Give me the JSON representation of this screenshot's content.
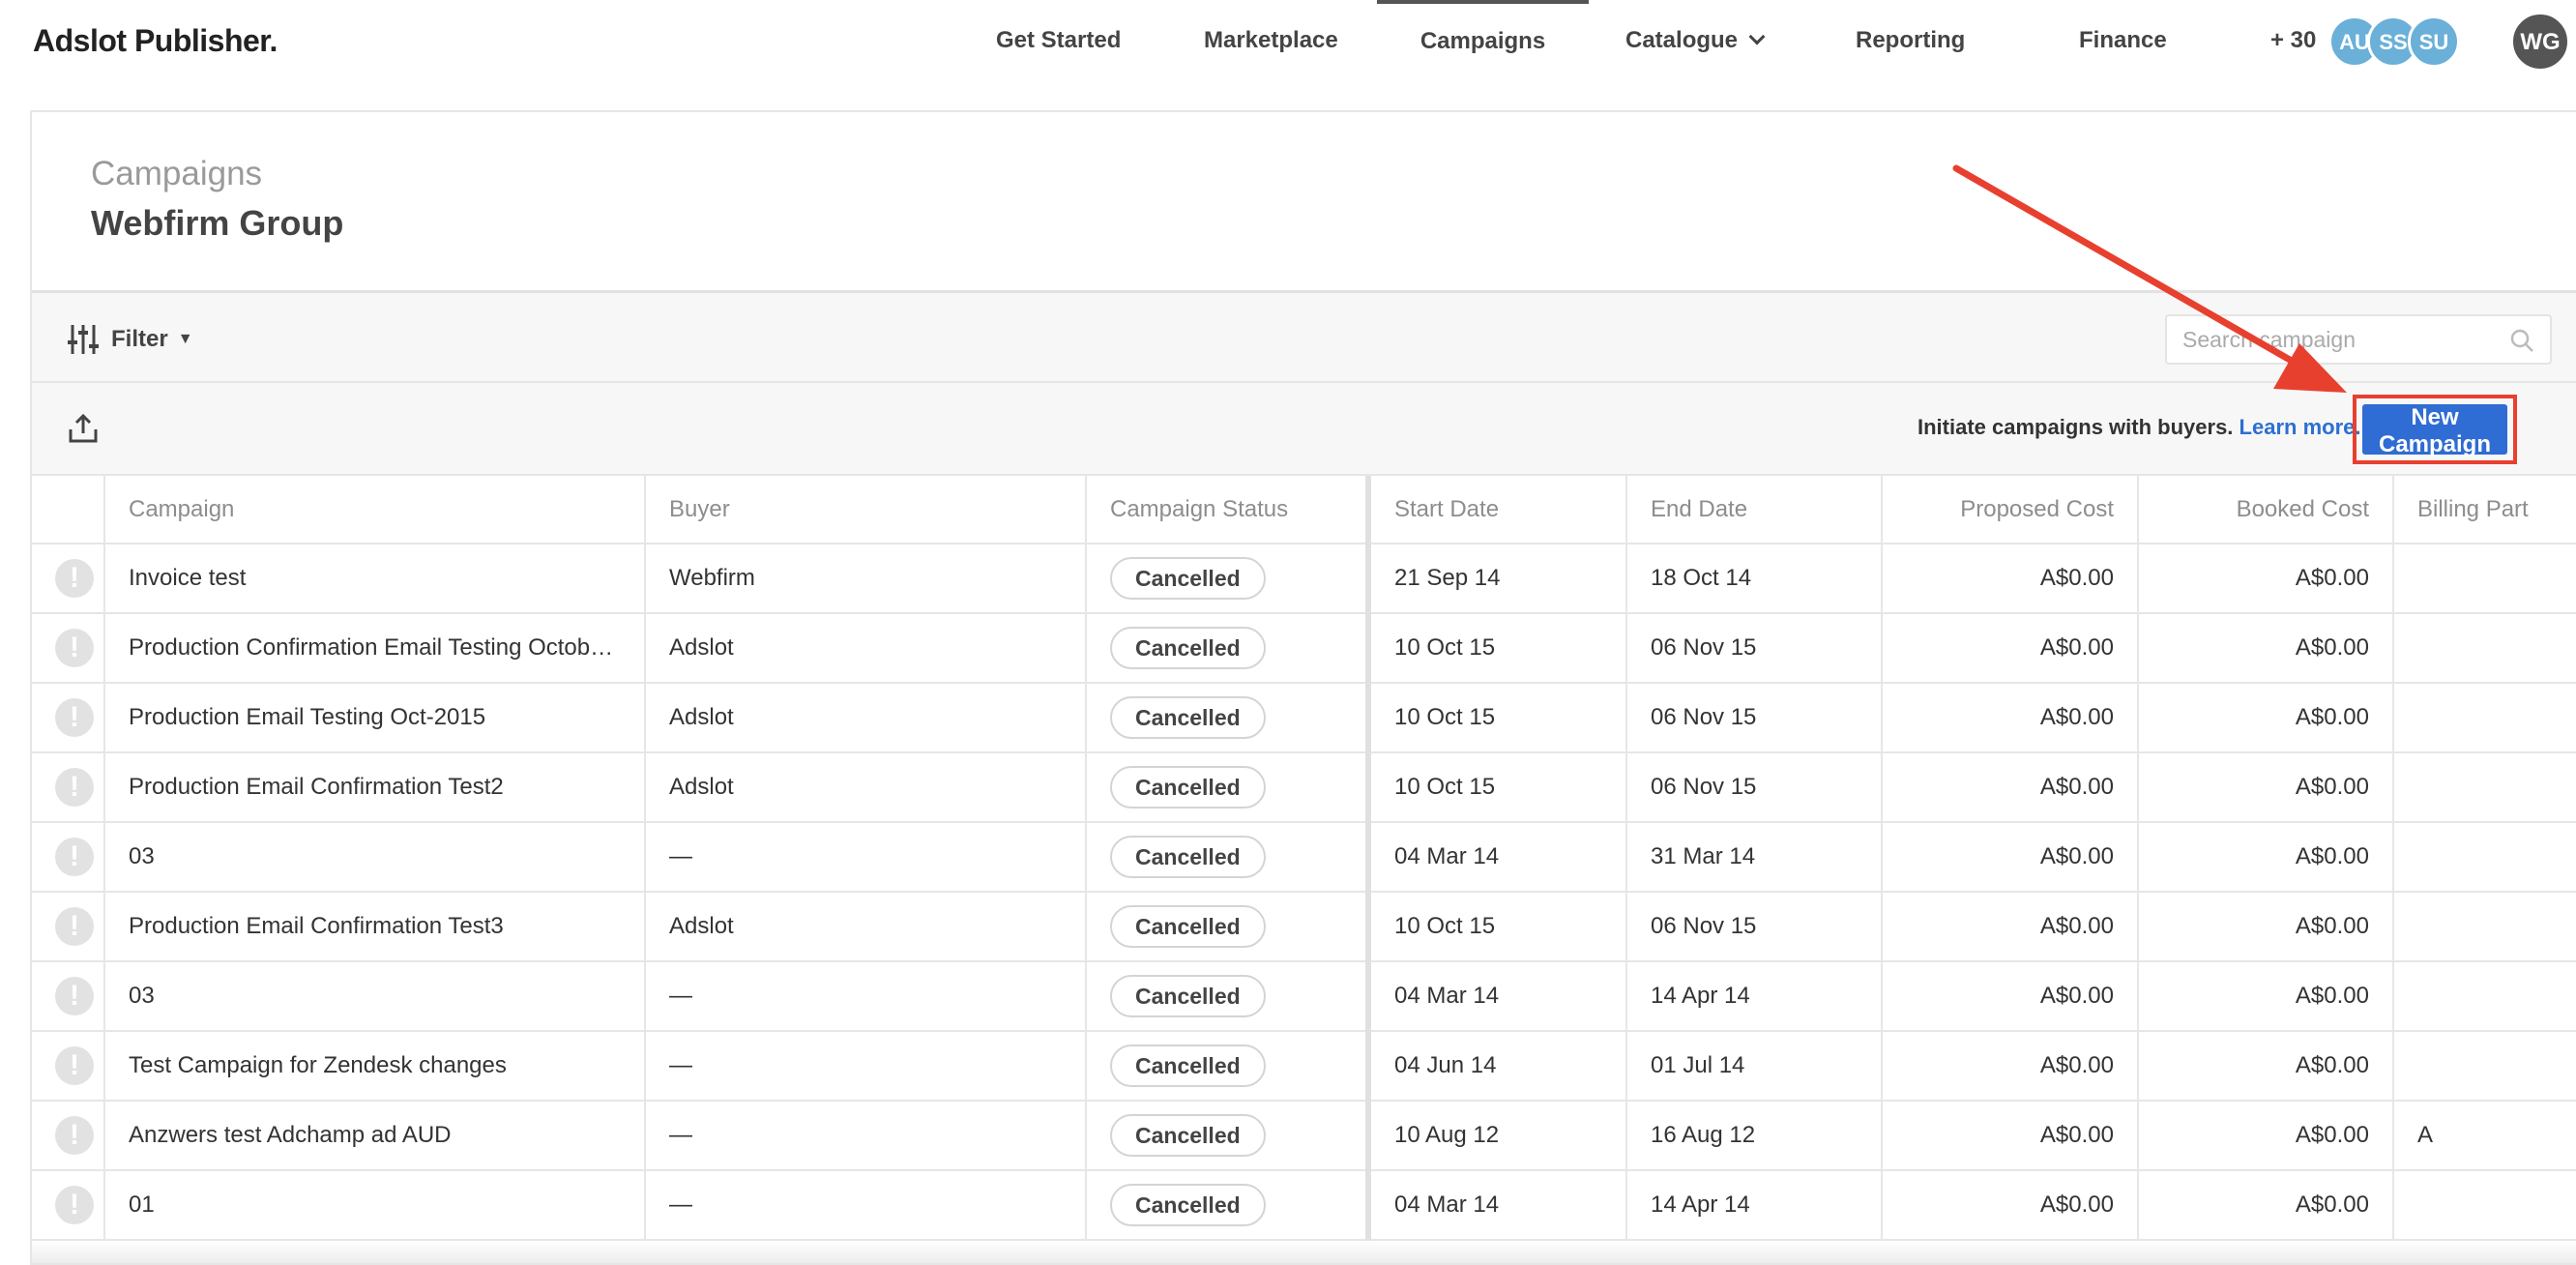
{
  "nav": {
    "brand": "Adslot Publisher.",
    "items": [
      {
        "label": "Get Started"
      },
      {
        "label": "Marketplace"
      },
      {
        "label": "Campaigns"
      },
      {
        "label": "Catalogue"
      },
      {
        "label": "Reporting"
      },
      {
        "label": "Finance"
      }
    ],
    "active": "Campaigns",
    "more_count": "+ 30",
    "avatars": [
      "AU",
      "SS",
      "SU"
    ],
    "user_initials": "WG"
  },
  "header": {
    "title": "Campaigns",
    "subtitle": "Webfirm Group"
  },
  "filter": {
    "label": "Filter",
    "caret": "▼",
    "search_placeholder": "Search campaign"
  },
  "actions": {
    "initiate_text": "Initiate campaigns with buyers.",
    "learn_more": "Learn more.",
    "new_campaign": "New Campaign"
  },
  "table": {
    "columns": [
      "Campaign",
      "Buyer",
      "Campaign Status",
      "Start Date",
      "End Date",
      "Proposed Cost",
      "Booked Cost",
      "Billing Part"
    ],
    "rows": [
      {
        "campaign": "Invoice test",
        "buyer": "Webfirm",
        "status": "Cancelled",
        "start": "21 Sep 14",
        "end": "18 Oct 14",
        "proposed": "A$0.00",
        "booked": "A$0.00",
        "billing": ""
      },
      {
        "campaign": "Production Confirmation Email Testing Octobe…",
        "buyer": "Adslot",
        "status": "Cancelled",
        "start": "10 Oct 15",
        "end": "06 Nov 15",
        "proposed": "A$0.00",
        "booked": "A$0.00",
        "billing": ""
      },
      {
        "campaign": "Production Email Testing Oct-2015",
        "buyer": "Adslot",
        "status": "Cancelled",
        "start": "10 Oct 15",
        "end": "06 Nov 15",
        "proposed": "A$0.00",
        "booked": "A$0.00",
        "billing": ""
      },
      {
        "campaign": "Production Email Confirmation Test2",
        "buyer": "Adslot",
        "status": "Cancelled",
        "start": "10 Oct 15",
        "end": "06 Nov 15",
        "proposed": "A$0.00",
        "booked": "A$0.00",
        "billing": ""
      },
      {
        "campaign": "03",
        "buyer": "—",
        "status": "Cancelled",
        "start": "04 Mar 14",
        "end": "31 Mar 14",
        "proposed": "A$0.00",
        "booked": "A$0.00",
        "billing": ""
      },
      {
        "campaign": "Production Email Confirmation Test3",
        "buyer": "Adslot",
        "status": "Cancelled",
        "start": "10 Oct 15",
        "end": "06 Nov 15",
        "proposed": "A$0.00",
        "booked": "A$0.00",
        "billing": ""
      },
      {
        "campaign": "03",
        "buyer": "—",
        "status": "Cancelled",
        "start": "04 Mar 14",
        "end": "14 Apr 14",
        "proposed": "A$0.00",
        "booked": "A$0.00",
        "billing": ""
      },
      {
        "campaign": "Test Campaign for Zendesk changes",
        "buyer": "—",
        "status": "Cancelled",
        "start": "04 Jun 14",
        "end": "01 Jul 14",
        "proposed": "A$0.00",
        "booked": "A$0.00",
        "billing": ""
      },
      {
        "campaign": "Anzwers test Adchamp ad AUD",
        "buyer": "—",
        "status": "Cancelled",
        "start": "10 Aug 12",
        "end": "16 Aug 12",
        "proposed": "A$0.00",
        "booked": "A$0.00",
        "billing": "A"
      },
      {
        "campaign": "01",
        "buyer": "—",
        "status": "Cancelled",
        "start": "04 Mar 14",
        "end": "14 Apr 14",
        "proposed": "A$0.00",
        "booked": "A$0.00",
        "billing": ""
      }
    ]
  },
  "annotation": {
    "arrow_color": "#e8402f",
    "target": "New Campaign"
  },
  "colors": {
    "accent": "#2f6cd3",
    "annotation": "#e8402f",
    "avatar": "#6ab0d8",
    "user_avatar": "#555555"
  }
}
